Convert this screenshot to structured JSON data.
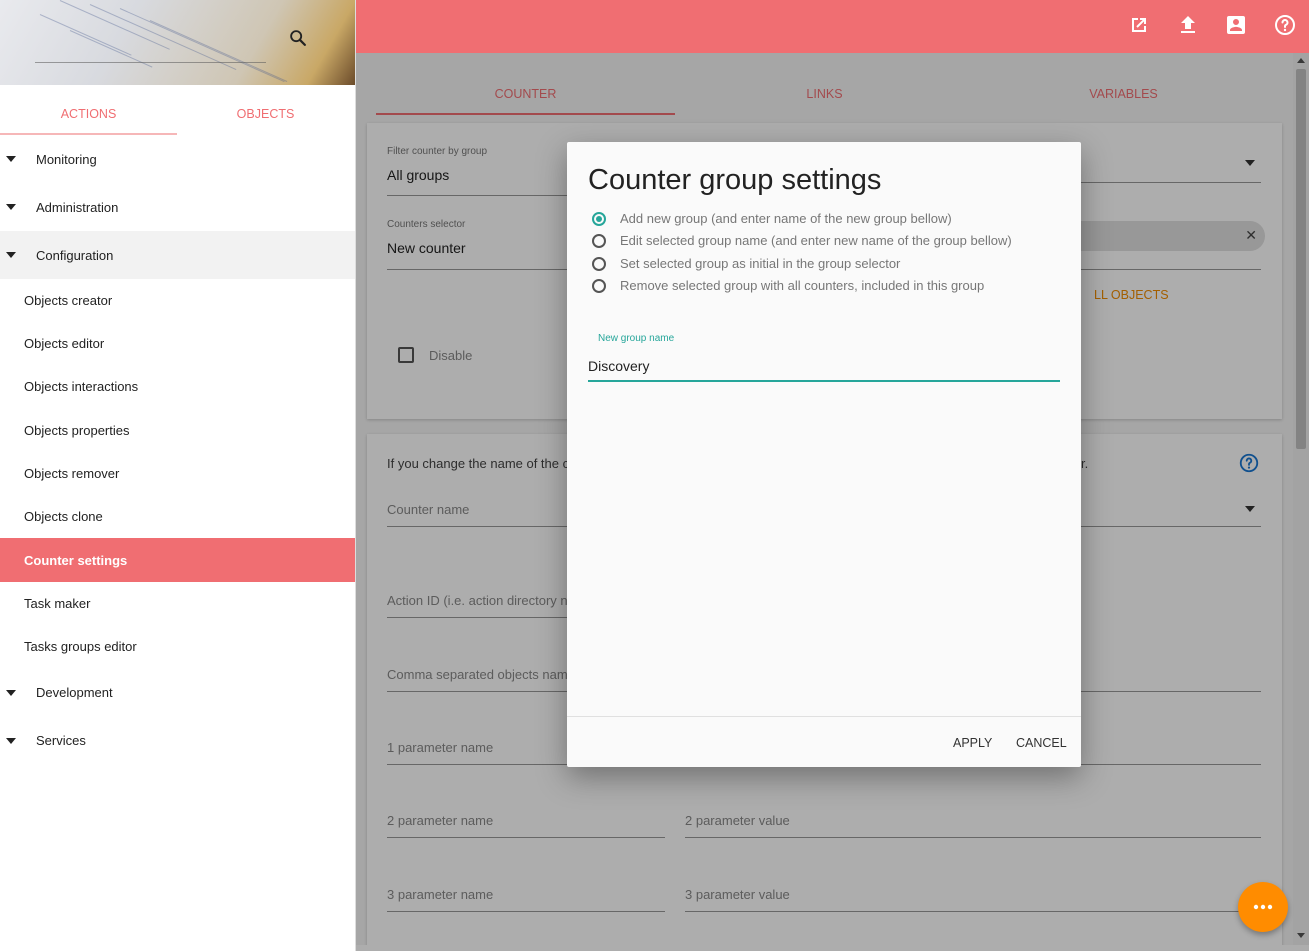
{
  "sidebar": {
    "tabs": [
      {
        "label": "ACTIONS",
        "active": true
      },
      {
        "label": "OBJECTS",
        "active": false
      }
    ],
    "groups_top": [
      {
        "label": "Monitoring"
      },
      {
        "label": "Administration"
      },
      {
        "label": "Configuration"
      }
    ],
    "items": [
      {
        "label": "Objects creator"
      },
      {
        "label": "Objects editor"
      },
      {
        "label": "Objects interactions"
      },
      {
        "label": "Objects properties"
      },
      {
        "label": "Objects remover"
      },
      {
        "label": "Objects clone"
      },
      {
        "label": "Counter settings"
      },
      {
        "label": "Task maker"
      },
      {
        "label": "Tasks groups editor"
      }
    ],
    "groups_bottom": [
      {
        "label": "Development"
      },
      {
        "label": "Services"
      }
    ]
  },
  "header": {
    "icons": [
      "open-in-new-icon",
      "upload-icon",
      "account-box-icon",
      "help-icon"
    ]
  },
  "main": {
    "tabs": [
      {
        "label": "COUNTER"
      },
      {
        "label": "LINKS"
      },
      {
        "label": "VARIABLES"
      }
    ],
    "filter_label": "Filter counter by group",
    "filter_value": "All groups",
    "selector_label": "Counters selector",
    "selector_value": "New counter",
    "all_objects_fragment": "LL OBJECTS",
    "disable_label": "Disable",
    "info_text_fragment": "If you change the name of the c",
    "info_text_end": "r.",
    "counter_name_placeholder": "Counter name",
    "action_id_placeholder": "Action ID (i.e. action directory n",
    "objects_placeholder": "Comma separated objects nam",
    "param1_name": "1 parameter name",
    "param2_name": "2 parameter name",
    "param2_value": "2 parameter value",
    "param3_name": "3 parameter name",
    "param3_value": "3 parameter value"
  },
  "dialog": {
    "title": "Counter group settings",
    "options": [
      {
        "label": "Add new group (and enter name of the new group bellow)",
        "checked": true
      },
      {
        "label": "Edit selected group name (and enter new name of the group bellow)",
        "checked": false
      },
      {
        "label": "Set selected group as initial in the group selector",
        "checked": false
      },
      {
        "label": "Remove selected group with all counters, included in this group",
        "checked": false
      }
    ],
    "input_label": "New group name",
    "input_value": "Discovery",
    "apply_label": "APPLY",
    "cancel_label": "CANCEL"
  },
  "colors": {
    "primary": "#f06e72",
    "accent": "#26a69a",
    "fab": "#ff8c00"
  }
}
